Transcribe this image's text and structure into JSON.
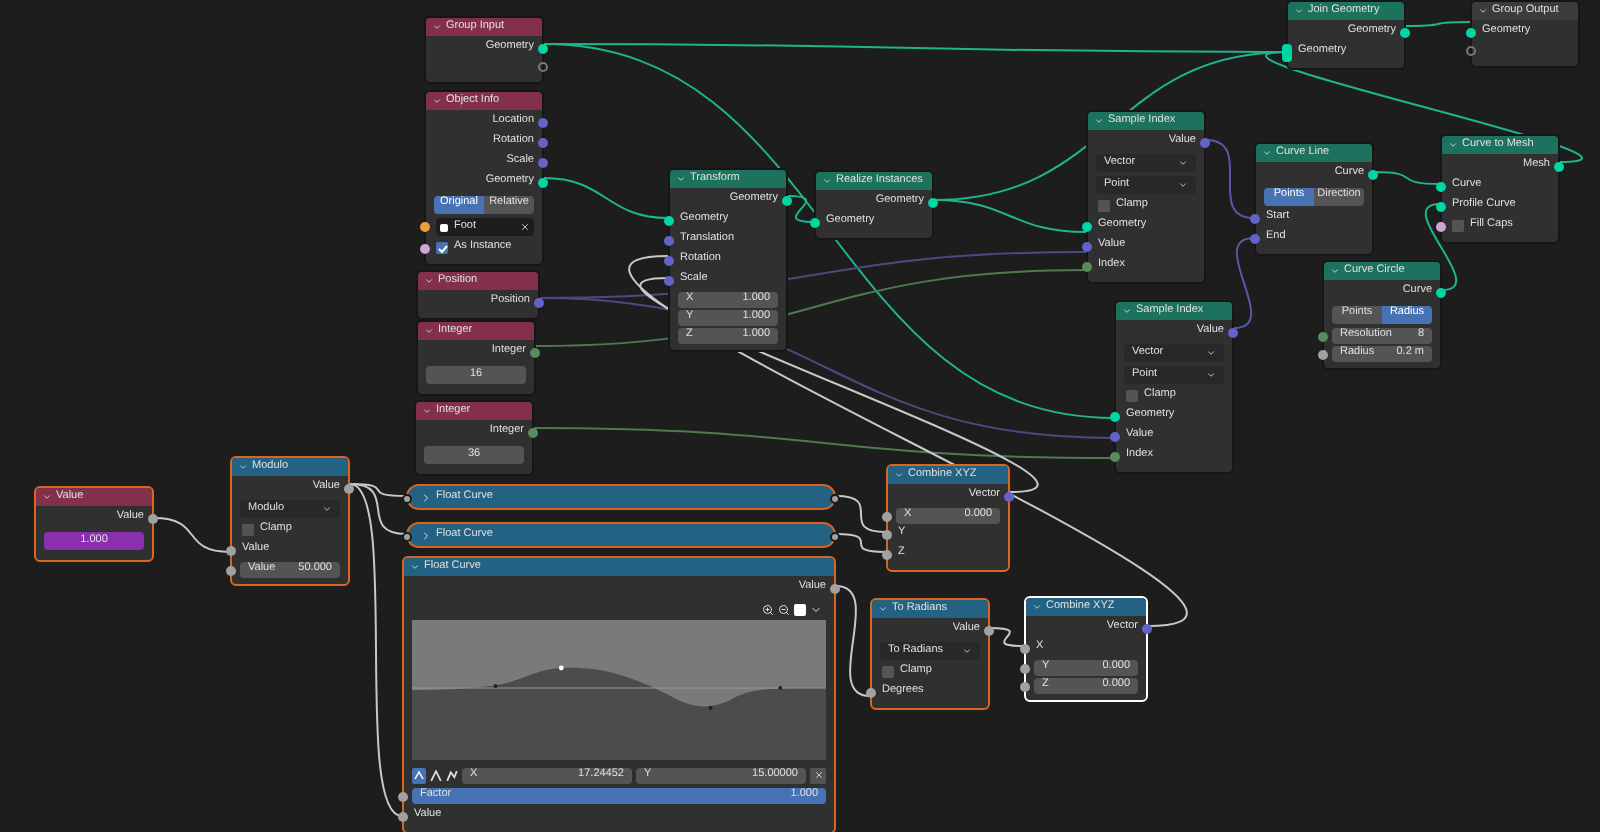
{
  "nodes": [
    {
      "title": "Group Input",
      "kind": "input",
      "selected": false,
      "active": false,
      "collapsed": false,
      "rows": [
        {
          "kind": "out",
          "label": "Geometry",
          "color": "#00d6a3"
        },
        {
          "kind": "virtual_out"
        }
      ]
    },
    {
      "title": "Object Info",
      "kind": "input",
      "selected": false,
      "active": false,
      "collapsed": false,
      "rows": [
        {
          "kind": "out",
          "label": "Location",
          "color": "#6363c7"
        },
        {
          "kind": "out",
          "label": "Rotation",
          "color": "#6363c7"
        },
        {
          "kind": "out",
          "label": "Scale",
          "color": "#6363c7"
        },
        {
          "kind": "out",
          "label": "Geometry",
          "color": "#00d6a3"
        },
        {
          "kind": "toggle",
          "options": [
            {
              "label": "Original",
              "selected": true
            },
            {
              "label": "Relative",
              "selected": false
            }
          ]
        },
        {
          "kind": "object",
          "value": "Foot",
          "color": "#ed9e40"
        },
        {
          "kind": "checkbox",
          "label": "As Instance",
          "checked": true,
          "color": "#cca6d6"
        }
      ]
    },
    {
      "title": "Position",
      "kind": "input",
      "selected": false,
      "active": false,
      "collapsed": false,
      "rows": [
        {
          "kind": "out",
          "label": "Position",
          "color": "#6363c7"
        }
      ]
    },
    {
      "title": "Integer",
      "kind": "input",
      "selected": false,
      "active": false,
      "collapsed": false,
      "rows": [
        {
          "kind": "out",
          "label": "Integer",
          "color": "#598c5c"
        },
        {
          "kind": "number",
          "value": "16",
          "keyed": false
        }
      ]
    },
    {
      "title": "Integer",
      "kind": "input",
      "selected": false,
      "active": false,
      "collapsed": false,
      "rows": [
        {
          "kind": "out",
          "label": "Integer",
          "color": "#598c5c"
        },
        {
          "kind": "number",
          "value": "36",
          "keyed": false
        }
      ]
    },
    {
      "title": "Transform",
      "kind": "geometry",
      "selected": false,
      "active": false,
      "collapsed": false,
      "rows": [
        {
          "kind": "out",
          "label": "Geometry",
          "color": "#00d6a3"
        },
        {
          "kind": "in",
          "label": "Geometry",
          "color": "#00d6a3"
        },
        {
          "kind": "in",
          "label": "Translation",
          "color": "#6363c7"
        },
        {
          "kind": "in",
          "label": "Rotation",
          "color": "#6363c7"
        },
        {
          "kind": "in",
          "label": "Scale",
          "color": "#6363c7"
        },
        {
          "kind": "field",
          "label": "X",
          "value": "1.000"
        },
        {
          "kind": "field",
          "label": "Y",
          "value": "1.000"
        },
        {
          "kind": "field",
          "label": "Z",
          "value": "1.000"
        }
      ]
    },
    {
      "title": "Realize Instances",
      "kind": "geometry",
      "selected": false,
      "active": false,
      "collapsed": false,
      "rows": [
        {
          "kind": "out",
          "label": "Geometry",
          "color": "#00d6a3"
        },
        {
          "kind": "in",
          "label": "Geometry",
          "color": "#00d6a3"
        }
      ]
    },
    {
      "title": "Join Geometry",
      "kind": "geometry",
      "selected": false,
      "active": false,
      "collapsed": false,
      "rows": [
        {
          "kind": "out",
          "label": "Geometry",
          "color": "#00d6a3"
        },
        {
          "kind": "multi_in",
          "label": "Geometry",
          "color": "#00d6a3"
        }
      ]
    },
    {
      "title": "Group Output",
      "kind": "output",
      "selected": false,
      "active": false,
      "collapsed": false,
      "rows": [
        {
          "kind": "in",
          "label": "Geometry",
          "color": "#00d6a3"
        },
        {
          "kind": "virtual_in"
        }
      ]
    },
    {
      "title": "Sample Index",
      "kind": "geometry",
      "selected": false,
      "active": false,
      "collapsed": false,
      "rows": [
        {
          "kind": "out",
          "label": "Value",
          "color": "#6363c7"
        },
        {
          "kind": "dropdown",
          "value": "Vector"
        },
        {
          "kind": "dropdown",
          "value": "Point"
        },
        {
          "kind": "checkbox",
          "label": "Clamp",
          "checked": false
        },
        {
          "kind": "in",
          "label": "Geometry",
          "color": "#00d6a3"
        },
        {
          "kind": "in",
          "label": "Value",
          "color": "#6363c7"
        },
        {
          "kind": "in",
          "label": "Index",
          "color": "#598c5c"
        }
      ]
    },
    {
      "title": "Sample Index",
      "kind": "geometry",
      "selected": false,
      "active": false,
      "collapsed": false,
      "rows": [
        {
          "kind": "out",
          "label": "Value",
          "color": "#6363c7"
        },
        {
          "kind": "dropdown",
          "value": "Vector"
        },
        {
          "kind": "dropdown",
          "value": "Point"
        },
        {
          "kind": "checkbox",
          "label": "Clamp",
          "checked": false
        },
        {
          "kind": "in",
          "label": "Geometry",
          "color": "#00d6a3"
        },
        {
          "kind": "in",
          "label": "Value",
          "color": "#6363c7"
        },
        {
          "kind": "in",
          "label": "Index",
          "color": "#598c5c"
        }
      ]
    },
    {
      "title": "Curve Line",
      "kind": "geometry",
      "selected": false,
      "active": false,
      "collapsed": false,
      "rows": [
        {
          "kind": "out",
          "label": "Curve",
          "color": "#00d6a3"
        },
        {
          "kind": "toggle",
          "options": [
            {
              "label": "Points",
              "selected": true
            },
            {
              "label": "Direction",
              "selected": false
            }
          ]
        },
        {
          "kind": "in",
          "label": "Start",
          "color": "#6363c7"
        },
        {
          "kind": "in",
          "label": "End",
          "color": "#6363c7"
        }
      ]
    },
    {
      "title": "Curve to Mesh",
      "kind": "geometry",
      "selected": false,
      "active": false,
      "collapsed": false,
      "rows": [
        {
          "kind": "out",
          "label": "Mesh",
          "color": "#00d6a3"
        },
        {
          "kind": "in",
          "label": "Curve",
          "color": "#00d6a3"
        },
        {
          "kind": "in",
          "label": "Profile Curve",
          "color": "#00d6a3"
        },
        {
          "kind": "checkbox",
          "label": "Fill Caps",
          "checked": false,
          "color": "#cca6d6"
        }
      ]
    },
    {
      "title": "Curve Circle",
      "kind": "geometry",
      "selected": false,
      "active": false,
      "collapsed": false,
      "rows": [
        {
          "kind": "out",
          "label": "Curve",
          "color": "#00d6a3"
        },
        {
          "kind": "toggle",
          "options": [
            {
              "label": "Points",
              "selected": false
            },
            {
              "label": "Radius",
              "selected": true
            }
          ]
        },
        {
          "kind": "field",
          "label": "Resolution",
          "value": "8",
          "color": "#598c5c"
        },
        {
          "kind": "field",
          "label": "Radius",
          "value": "0.2 m",
          "color": "#a1a1a1"
        }
      ]
    },
    {
      "title": "Value",
      "kind": "input",
      "selected": true,
      "active": false,
      "collapsed": false,
      "rows": [
        {
          "kind": "out",
          "label": "Value",
          "color": "#a1a1a1"
        },
        {
          "kind": "number",
          "value": "1.000",
          "keyed": true
        }
      ]
    },
    {
      "title": "Modulo",
      "kind": "converter",
      "selected": true,
      "active": false,
      "collapsed": false,
      "rows": [
        {
          "kind": "out",
          "label": "Value",
          "color": "#a1a1a1"
        },
        {
          "kind": "dropdown",
          "value": "Modulo"
        },
        {
          "kind": "checkbox",
          "label": "Clamp",
          "checked": false
        },
        {
          "kind": "in",
          "label": "Value",
          "color": "#a1a1a1"
        },
        {
          "kind": "field",
          "label": "Value",
          "value": "50.000",
          "color": "#a1a1a1"
        }
      ]
    },
    {
      "title": "Float Curve",
      "kind": "converter",
      "selected": true,
      "active": false,
      "collapsed": true
    },
    {
      "title": "Float Curve",
      "kind": "converter",
      "selected": true,
      "active": false,
      "collapsed": true
    },
    {
      "title": "Float Curve",
      "kind": "converter",
      "selected": true,
      "active": false,
      "collapsed": false,
      "rows": [
        {
          "kind": "out",
          "label": "Value",
          "color": "#a1a1a1"
        },
        {
          "kind": "curve",
          "x_label": "X",
          "x_value": "17.24452",
          "y_label": "Y",
          "y_value": "15.00000"
        },
        {
          "kind": "factor",
          "label": "Factor",
          "value": "1.000",
          "level": 1,
          "color": "#a1a1a1"
        },
        {
          "kind": "in",
          "label": "Value",
          "color": "#a1a1a1"
        }
      ]
    },
    {
      "title": "Combine XYZ",
      "kind": "converter",
      "selected": true,
      "active": false,
      "collapsed": false,
      "rows": [
        {
          "kind": "out",
          "label": "Vector",
          "color": "#6363c7"
        },
        {
          "kind": "field",
          "label": "X",
          "value": "0.000",
          "color": "#a1a1a1"
        },
        {
          "kind": "in",
          "label": "Y",
          "color": "#a1a1a1"
        },
        {
          "kind": "in",
          "label": "Z",
          "color": "#a1a1a1"
        }
      ]
    },
    {
      "title": "To Radians",
      "kind": "converter",
      "selected": true,
      "active": false,
      "collapsed": false,
      "rows": [
        {
          "kind": "out",
          "label": "Value",
          "color": "#a1a1a1"
        },
        {
          "kind": "dropdown",
          "value": "To Radians"
        },
        {
          "kind": "checkbox",
          "label": "Clamp",
          "checked": false
        },
        {
          "kind": "in",
          "label": "Degrees",
          "color": "#a1a1a1"
        }
      ]
    },
    {
      "title": "Combine XYZ",
      "kind": "converter",
      "selected": true,
      "active": true,
      "collapsed": false,
      "rows": [
        {
          "kind": "out",
          "label": "Vector",
          "color": "#6363c7"
        },
        {
          "kind": "in",
          "label": "X",
          "color": "#a1a1a1"
        },
        {
          "kind": "field",
          "label": "Y",
          "value": "0.000",
          "color": "#a1a1a1"
        },
        {
          "kind": "field",
          "label": "Z",
          "value": "0.000",
          "color": "#a1a1a1"
        }
      ]
    }
  ]
}
